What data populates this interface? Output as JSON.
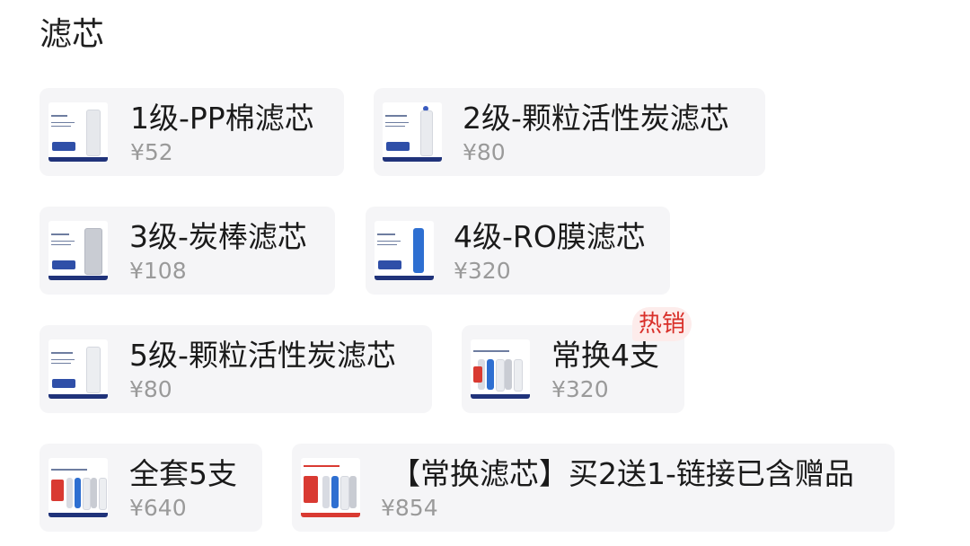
{
  "section": {
    "title": "滤芯"
  },
  "options": [
    {
      "name": "1级-PP棉滤芯",
      "price": "¥52",
      "icon": "filter-cartridge-thumbnail"
    },
    {
      "name": "2级-颗粒活性炭滤芯",
      "price": "¥80",
      "icon": "filter-cartridge-thumbnail"
    },
    {
      "name": "3级-炭棒滤芯",
      "price": "¥108",
      "icon": "filter-cartridge-thumbnail"
    },
    {
      "name": "4级-RO膜滤芯",
      "price": "¥320",
      "icon": "filter-cartridge-thumbnail"
    },
    {
      "name": "5级-颗粒活性炭滤芯",
      "price": "¥80",
      "icon": "filter-cartridge-thumbnail"
    },
    {
      "name": "常换4支",
      "price": "¥320",
      "tag": "热销",
      "icon": "filter-set-thumbnail"
    },
    {
      "name": "全套5支",
      "price": "¥640",
      "icon": "filter-set-thumbnail"
    },
    {
      "name": "【常换滤芯】买2送1-链接已含赠品",
      "price": "¥854",
      "icon": "filter-set-thumbnail"
    }
  ],
  "colors": {
    "card_background": "#f5f5f7",
    "title_text": "#1a1a1a",
    "price_text": "#9a9a9a",
    "hot_tag_background": "#fdeceb",
    "hot_tag_text": "#d9302a",
    "brand_blue": "#20337a"
  }
}
